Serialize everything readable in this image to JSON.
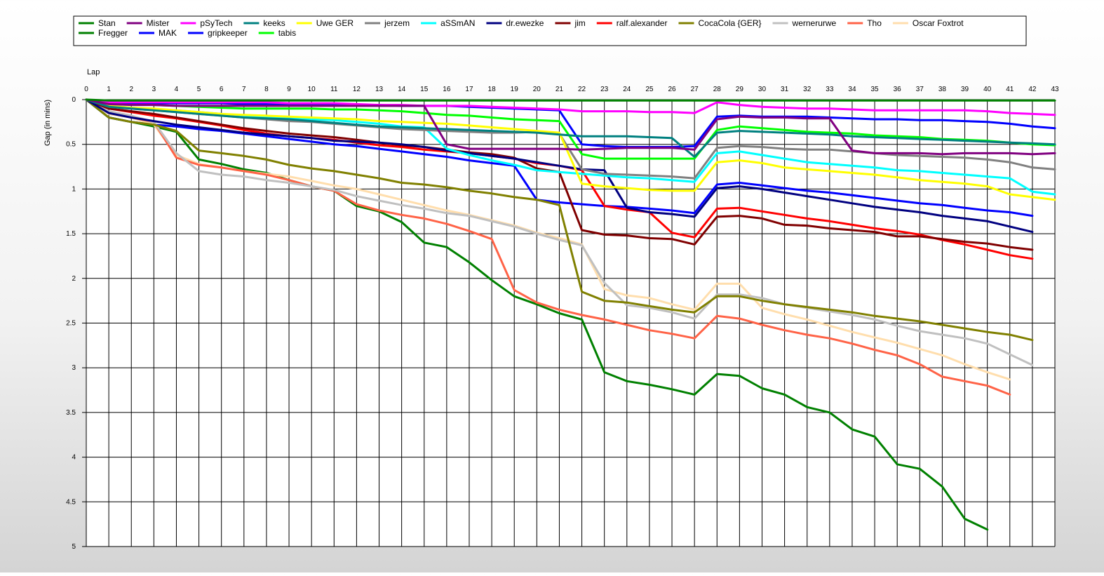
{
  "chart_data": {
    "type": "line",
    "xlabel": "Lap",
    "ylabel": "Gap (in mins)",
    "xlim": [
      0,
      43
    ],
    "ylim": [
      0,
      5
    ],
    "y_inverted": true,
    "grid": true,
    "legend": "top",
    "x_ticks": [
      "0",
      "1",
      "2",
      "3",
      "4",
      "5",
      "6",
      "7",
      "8",
      "9",
      "10",
      "11",
      "12",
      "13",
      "14",
      "15",
      "16",
      "17",
      "18",
      "19",
      "20",
      "21",
      "22",
      "23",
      "24",
      "25",
      "26",
      "27",
      "28",
      "29",
      "30",
      "31",
      "32",
      "33",
      "34",
      "35",
      "36",
      "37",
      "38",
      "39",
      "40",
      "41",
      "42",
      "43"
    ],
    "y_ticks": [
      "0",
      "0.5",
      "1",
      "1.5",
      "2",
      "2.5",
      "3",
      "3.5",
      "4",
      "4.5",
      "5"
    ],
    "series": [
      {
        "name": "Stan",
        "color": "#008000",
        "values": [
          0,
          0.01,
          0.01,
          0.01,
          0.01,
          0.01,
          0.01,
          0.01,
          0.01,
          0.01,
          0.01,
          0.01,
          0.01,
          0.01,
          0.01,
          0.01,
          0.01,
          0.01,
          0.01,
          0.01,
          0.01,
          0.01,
          0.01,
          0.01,
          0.01,
          0.01,
          0.01,
          0.01,
          0.01,
          0.01,
          0.01,
          0.01,
          0.01,
          0.01,
          0.01,
          0.01,
          0.01,
          0.01,
          0.01,
          0.01,
          0.01,
          0.01,
          0.01,
          0.01
        ]
      },
      {
        "name": "Mister",
        "color": "#800080",
        "values": [
          0,
          0.05,
          0.06,
          0.06,
          0.07,
          0.07,
          0.07,
          0.07,
          0.07,
          0.07,
          0.07,
          0.07,
          0.07,
          0.07,
          0.07,
          0.07,
          0.5,
          0.55,
          0.55,
          0.55,
          0.55,
          0.55,
          0.56,
          0.55,
          0.54,
          0.54,
          0.54,
          0.56,
          0.22,
          0.19,
          0.2,
          0.2,
          0.21,
          0.21,
          0.57,
          0.6,
          0.6,
          0.6,
          0.61,
          0.6,
          0.6,
          0.6,
          0.61,
          0.6
        ]
      },
      {
        "name": "pSyTech",
        "color": "#ff00ff",
        "values": [
          0,
          0.03,
          0.03,
          0.03,
          0.03,
          0.03,
          0.03,
          0.03,
          0.03,
          0.04,
          0.04,
          0.04,
          0.05,
          0.06,
          0.06,
          0.07,
          0.07,
          0.07,
          0.08,
          0.09,
          0.1,
          0.11,
          0.13,
          0.13,
          0.13,
          0.14,
          0.14,
          0.15,
          0.03,
          0.06,
          0.08,
          0.09,
          0.1,
          0.1,
          0.11,
          0.12,
          0.12,
          0.12,
          0.12,
          0.12,
          0.13,
          0.15,
          0.16,
          0.17
        ]
      },
      {
        "name": "keeks",
        "color": "#008080",
        "values": [
          0,
          0.08,
          0.1,
          0.12,
          0.14,
          0.16,
          0.18,
          0.2,
          0.21,
          0.22,
          0.24,
          0.26,
          0.28,
          0.3,
          0.31,
          0.32,
          0.33,
          0.34,
          0.35,
          0.36,
          0.37,
          0.39,
          0.41,
          0.41,
          0.41,
          0.42,
          0.43,
          0.64,
          0.37,
          0.35,
          0.36,
          0.37,
          0.38,
          0.39,
          0.41,
          0.42,
          0.43,
          0.44,
          0.45,
          0.46,
          0.47,
          0.48,
          0.49,
          0.5
        ]
      },
      {
        "name": "Uwe GER",
        "color": "#ffff00",
        "values": [
          0,
          0.07,
          0.09,
          0.1,
          0.12,
          0.14,
          0.16,
          0.17,
          0.18,
          0.19,
          0.2,
          0.21,
          0.22,
          0.24,
          0.25,
          0.26,
          0.27,
          0.29,
          0.31,
          0.33,
          0.35,
          0.37,
          0.94,
          0.97,
          0.99,
          1.01,
          1.02,
          1.02,
          0.7,
          0.68,
          0.71,
          0.76,
          0.78,
          0.8,
          0.82,
          0.84,
          0.87,
          0.9,
          0.92,
          0.94,
          0.97,
          1.06,
          1.09,
          1.12
        ]
      },
      {
        "name": "jerzem",
        "color": "#808080",
        "values": [
          0,
          0.08,
          0.1,
          0.12,
          0.14,
          0.16,
          0.18,
          0.2,
          0.22,
          0.24,
          0.25,
          0.27,
          0.29,
          0.31,
          0.33,
          0.34,
          0.35,
          0.36,
          0.37,
          0.37,
          0.36,
          0.38,
          0.78,
          0.83,
          0.84,
          0.85,
          0.86,
          0.88,
          0.54,
          0.52,
          0.53,
          0.55,
          0.56,
          0.56,
          0.58,
          0.6,
          0.62,
          0.63,
          0.64,
          0.65,
          0.67,
          0.7,
          0.76,
          0.78
        ]
      },
      {
        "name": "aSSmAN",
        "color": "#00ffff",
        "values": [
          0,
          0.07,
          0.09,
          0.11,
          0.12,
          0.14,
          0.16,
          0.18,
          0.2,
          0.21,
          0.22,
          0.23,
          0.25,
          0.27,
          0.3,
          0.31,
          0.55,
          0.62,
          0.68,
          0.73,
          0.79,
          0.81,
          0.83,
          0.85,
          0.87,
          0.88,
          0.9,
          0.92,
          0.6,
          0.58,
          0.62,
          0.66,
          0.7,
          0.72,
          0.74,
          0.76,
          0.79,
          0.8,
          0.82,
          0.84,
          0.86,
          0.88,
          1.03,
          1.06
        ]
      },
      {
        "name": "dr.ewezke",
        "color": "#000080",
        "values": [
          0,
          0.15,
          0.2,
          0.24,
          0.28,
          0.31,
          0.34,
          0.37,
          0.39,
          0.41,
          0.43,
          0.46,
          0.47,
          0.48,
          0.5,
          0.53,
          0.57,
          0.6,
          0.63,
          0.66,
          0.7,
          0.74,
          0.78,
          0.79,
          1.21,
          1.26,
          1.28,
          1.31,
          0.99,
          0.97,
          1.0,
          1.04,
          1.08,
          1.12,
          1.16,
          1.2,
          1.23,
          1.26,
          1.3,
          1.33,
          1.36,
          1.42,
          1.48
        ]
      },
      {
        "name": "jim",
        "color": "#800000",
        "values": [
          0,
          0.1,
          0.13,
          0.16,
          0.2,
          0.24,
          0.28,
          0.32,
          0.35,
          0.38,
          0.4,
          0.42,
          0.45,
          0.48,
          0.51,
          0.53,
          0.56,
          0.59,
          0.61,
          0.65,
          0.77,
          0.81,
          1.46,
          1.51,
          1.52,
          1.55,
          1.56,
          1.62,
          1.31,
          1.3,
          1.33,
          1.4,
          1.41,
          1.44,
          1.46,
          1.48,
          1.53,
          1.53,
          1.56,
          1.59,
          1.61,
          1.65,
          1.68
        ]
      },
      {
        "name": "ralf.alexander",
        "color": "#ff0000",
        "values": [
          0,
          0.1,
          0.14,
          0.18,
          0.21,
          0.25,
          0.29,
          0.34,
          0.38,
          0.41,
          0.43,
          0.45,
          0.48,
          0.51,
          0.53,
          0.56,
          0.58,
          0.6,
          0.63,
          0.66,
          0.71,
          0.74,
          0.79,
          1.19,
          1.23,
          1.26,
          1.49,
          1.54,
          1.22,
          1.21,
          1.25,
          1.29,
          1.33,
          1.36,
          1.4,
          1.44,
          1.47,
          1.51,
          1.57,
          1.62,
          1.68,
          1.74,
          1.78
        ]
      },
      {
        "name": "CocaCola {GER}",
        "color": "#808000",
        "values": [
          0,
          0.2,
          0.25,
          0.28,
          0.35,
          0.57,
          0.6,
          0.63,
          0.67,
          0.73,
          0.77,
          0.8,
          0.84,
          0.88,
          0.93,
          0.95,
          0.98,
          1.02,
          1.05,
          1.09,
          1.12,
          1.18,
          2.15,
          2.25,
          2.27,
          2.31,
          2.35,
          2.38,
          2.2,
          2.2,
          2.25,
          2.29,
          2.32,
          2.35,
          2.38,
          2.42,
          2.45,
          2.48,
          2.52,
          2.56,
          2.6,
          2.63,
          2.69
        ]
      },
      {
        "name": "wernerurwe",
        "color": "#c0c0c0",
        "values": [
          0,
          0.13,
          0.18,
          0.25,
          0.6,
          0.8,
          0.84,
          0.86,
          0.9,
          0.93,
          0.97,
          1.01,
          1.08,
          1.13,
          1.18,
          1.22,
          1.27,
          1.3,
          1.36,
          1.42,
          1.5,
          1.57,
          1.63,
          2.05,
          2.3,
          2.33,
          2.38,
          2.45,
          2.18,
          2.18,
          2.22,
          2.29,
          2.33,
          2.37,
          2.41,
          2.46,
          2.53,
          2.59,
          2.63,
          2.67,
          2.73,
          2.85,
          2.97
        ]
      },
      {
        "name": "Tho",
        "color": "#ff6347",
        "values": [
          0,
          0.14,
          0.2,
          0.25,
          0.65,
          0.73,
          0.76,
          0.8,
          0.84,
          0.9,
          0.97,
          1.02,
          1.17,
          1.24,
          1.29,
          1.33,
          1.39,
          1.47,
          1.56,
          2.13,
          2.27,
          2.35,
          2.41,
          2.46,
          2.52,
          2.58,
          2.62,
          2.67,
          2.42,
          2.45,
          2.52,
          2.58,
          2.63,
          2.67,
          2.73,
          2.8,
          2.86,
          2.96,
          3.1,
          3.15,
          3.2,
          3.3
        ]
      },
      {
        "name": "Oscar Foxtrot",
        "color": "#ffdead",
        "values": [
          0,
          0.16,
          0.2,
          0.28,
          0.62,
          0.72,
          0.76,
          0.8,
          0.83,
          0.86,
          0.91,
          0.96,
          1.0,
          1.06,
          1.12,
          1.18,
          1.24,
          1.29,
          1.35,
          1.41,
          1.49,
          1.55,
          1.62,
          2.12,
          2.19,
          2.22,
          2.29,
          2.35,
          2.06,
          2.06,
          2.33,
          2.4,
          2.46,
          2.53,
          2.6,
          2.66,
          2.72,
          2.79,
          2.86,
          2.96,
          3.05,
          3.13
        ]
      },
      {
        "name": "Fregger",
        "color": "#008000",
        "values": [
          0,
          0.2,
          0.25,
          0.3,
          0.36,
          0.67,
          0.72,
          0.78,
          0.82,
          0.9,
          0.97,
          1.02,
          1.19,
          1.25,
          1.37,
          1.6,
          1.65,
          1.82,
          2.02,
          2.2,
          2.29,
          2.39,
          2.46,
          3.05,
          3.15,
          3.19,
          3.24,
          3.3,
          3.07,
          3.09,
          3.23,
          3.3,
          3.44,
          3.5,
          3.69,
          3.77,
          4.08,
          4.13,
          4.33,
          4.69,
          4.81
        ]
      },
      {
        "name": "MAK",
        "color": "#0000ff",
        "values": [
          0,
          0.03,
          0.04,
          0.04,
          0.04,
          0.04,
          0.04,
          0.05,
          0.05,
          0.05,
          0.05,
          0.05,
          0.06,
          0.06,
          0.07,
          0.07,
          0.07,
          0.08,
          0.09,
          0.1,
          0.11,
          0.12,
          0.5,
          0.52,
          0.53,
          0.53,
          0.53,
          0.52,
          0.19,
          0.18,
          0.19,
          0.19,
          0.19,
          0.2,
          0.21,
          0.22,
          0.22,
          0.23,
          0.23,
          0.24,
          0.25,
          0.27,
          0.3,
          0.32
        ]
      },
      {
        "name": "gripkeeper",
        "color": "#0000ff",
        "values": [
          0,
          0.2,
          0.25,
          0.28,
          0.3,
          0.33,
          0.35,
          0.38,
          0.41,
          0.44,
          0.47,
          0.5,
          0.52,
          0.55,
          0.58,
          0.61,
          0.64,
          0.68,
          0.71,
          0.74,
          1.12,
          1.15,
          1.17,
          1.19,
          1.2,
          1.22,
          1.24,
          1.27,
          0.95,
          0.93,
          0.96,
          0.99,
          1.02,
          1.04,
          1.07,
          1.1,
          1.13,
          1.16,
          1.18,
          1.21,
          1.24,
          1.26,
          1.3
        ]
      },
      {
        "name": "tabis",
        "color": "#00ff00",
        "values": [
          0,
          0.04,
          0.05,
          0.06,
          0.07,
          0.08,
          0.09,
          0.1,
          0.1,
          0.1,
          0.1,
          0.11,
          0.11,
          0.12,
          0.13,
          0.15,
          0.17,
          0.18,
          0.2,
          0.22,
          0.23,
          0.24,
          0.61,
          0.66,
          0.66,
          0.66,
          0.66,
          0.66,
          0.34,
          0.3,
          0.32,
          0.34,
          0.36,
          0.37,
          0.38,
          0.4,
          0.41,
          0.42,
          0.44,
          0.45,
          0.46,
          0.48,
          0.5,
          0.51
        ]
      }
    ]
  }
}
